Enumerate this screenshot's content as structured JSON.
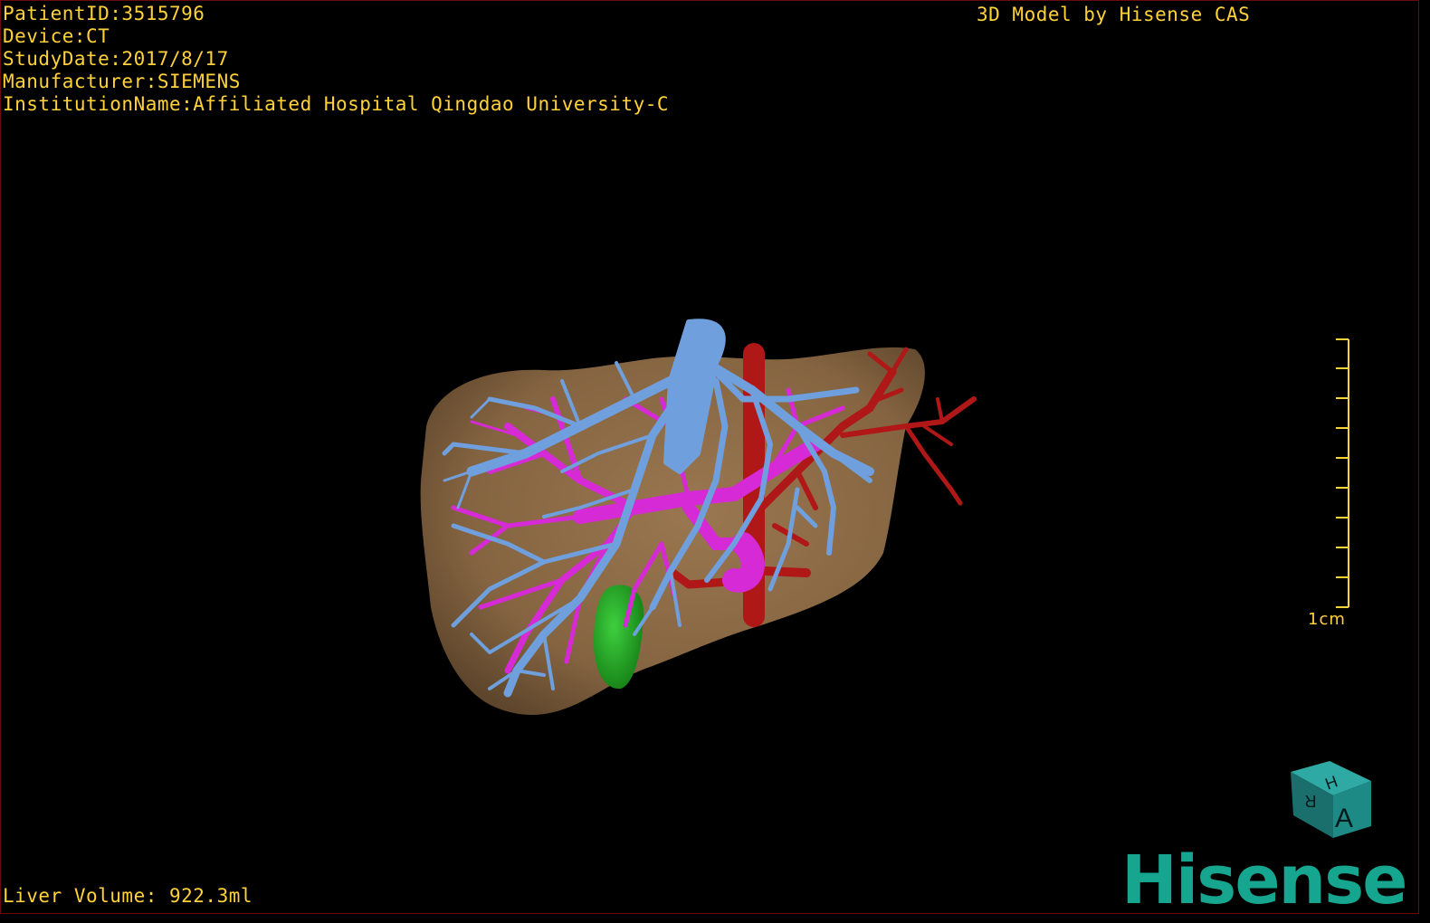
{
  "overlay": {
    "patient_id": "PatientID:3515796",
    "device": "Device:CT",
    "study_date": "StudyDate:2017/8/17",
    "manufacturer": "Manufacturer:SIEMENS",
    "institution": "InstitutionName:Affiliated Hospital Qingdao University-C",
    "credit": "3D Model by Hisense CAS",
    "liver_volume": "Liver Volume: 922.3ml"
  },
  "scale_bar": {
    "label": "1cm"
  },
  "orientation_cube": {
    "front": "A",
    "top": "H",
    "side": "R"
  },
  "brand": {
    "logo_text": "Hisense"
  },
  "colors": {
    "text": "#ffd23a",
    "liver": "#8a6a45",
    "hepatic_vein": "#6f9fdc",
    "portal_vein": "#d62ad6",
    "artery": "#b01818",
    "gallbladder": "#1f9a1f",
    "logo": "#16a58f",
    "cube": "#1e8a86"
  }
}
